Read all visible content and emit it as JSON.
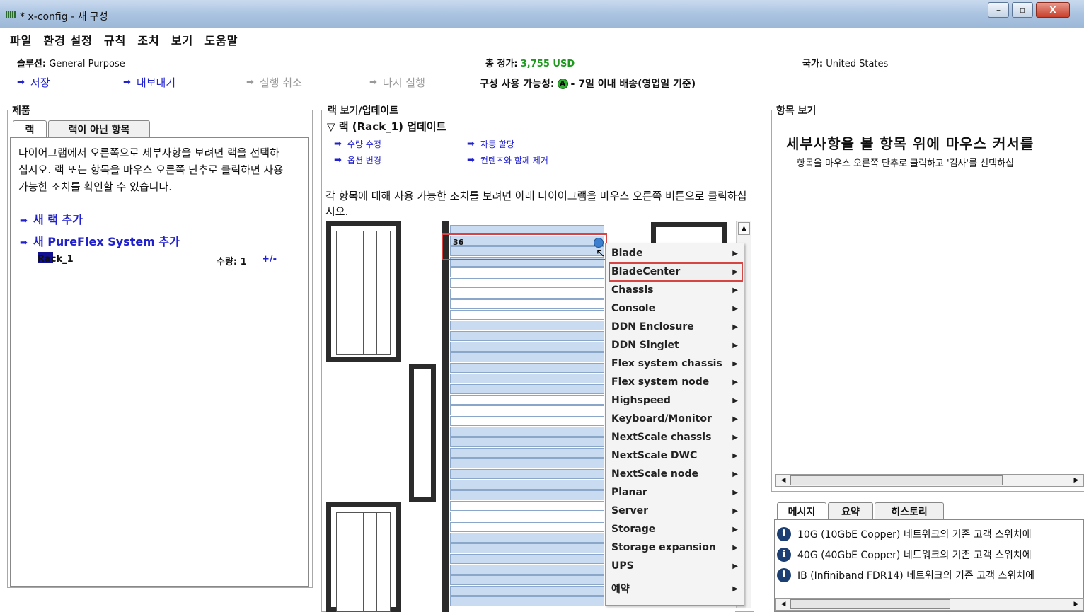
{
  "window": {
    "title": "* x-config - 새 구성",
    "min": "–",
    "max": "▫",
    "close": "X"
  },
  "menu": [
    "파일",
    "환경 설정",
    "규칙",
    "조치",
    "보기",
    "도움말"
  ],
  "info": {
    "solution_label": "솔루션:",
    "solution_value": "General Purpose",
    "price_label": "총 정가:",
    "price_value": "3,755 USD",
    "country_label": "국가:",
    "country_value": "United States",
    "availability_label": "구성 사용 가능성:",
    "availability_icon": "A",
    "availability_value": "- 7일 이내 배송(영업일 기준)"
  },
  "actions": {
    "save": "저장",
    "export": "내보내기",
    "undo": "실행 취소",
    "redo": "다시 실행"
  },
  "products": {
    "title": "제품",
    "tabs": [
      "랙",
      "랙이 아닌 항목"
    ],
    "description": "다이어그램에서 오른쪽으로 세부사항을 보려면 랙을 선택하십시오. 랙 또는 항목을 마우스 오른쪽 단추로 클릭하면 사용 가능한 조치를 확인할 수 있습니다.",
    "add_rack": "새 랙 추가",
    "add_pureflex": "새 PureFlex System 추가",
    "rack_name": "Rack_1",
    "qty_label": "수량: 1",
    "qty_adjust": "+/-",
    "rack_color": "#101090"
  },
  "rackview": {
    "title": "랙 보기/업데이트",
    "subtitle": "▽ 랙 (Rack_1) 업데이트",
    "links": [
      "수량 수정",
      "자동 할당",
      "옵션 변경",
      "컨텐츠와 함께 제거"
    ],
    "description": "각 항목에 대해 사용 가능한 조치를 보려면 아래 다이어그램을 마우스 오른쪽 버튼으로 클릭하십시오.",
    "slot_number": "36"
  },
  "context_menu": [
    "Blade",
    "BladeCenter",
    "Chassis",
    "Console",
    "DDN Enclosure",
    "DDN Singlet",
    "Flex system chassis",
    "Flex system node",
    "Highspeed",
    "Keyboard/Monitor",
    "NextScale chassis",
    "NextScale DWC",
    "NextScale node",
    "Planar",
    "Server",
    "Storage",
    "Storage expansion",
    "UPS",
    "예약"
  ],
  "item_view": {
    "title": "항목 보기",
    "headline": "세부사항을 볼 항목 위에 마우스 커서를",
    "hint": "항목을 마우스 오른쪽 단추로 클릭하고 '검사'를 선택하십"
  },
  "messages": {
    "tabs": [
      "메시지",
      "요약",
      "히스토리"
    ],
    "items": [
      "10G (10GbE Copper) 네트워크의 기존 고객 스위치에",
      "40G (40GbE Copper) 네트워크의 기존 고객 스위치에",
      "IB (Infiniband FDR14) 네트워크의 기존 고객 스위치에"
    ],
    "icon": "i"
  },
  "colors": {
    "link": "#2222cc",
    "highlight": "#d64444",
    "price": "#1f9a1f",
    "slot": "#c9dbf0"
  }
}
